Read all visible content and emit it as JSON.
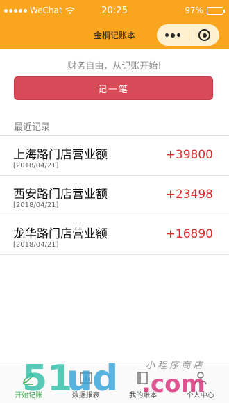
{
  "status_bar": {
    "carrier": "WeChat",
    "time": "20:25",
    "battery": "97%",
    "battery_level": 0.97
  },
  "nav": {
    "title": "金桐记账本"
  },
  "main": {
    "slogan": "财务自由，从记账开始!",
    "record_button": "记一笔",
    "section_title": "最近记录",
    "records": [
      {
        "name": "上海路门店营业额",
        "date": "[2018/04/21]",
        "amount": "+39800"
      },
      {
        "name": "西安路门店营业额",
        "date": "[2018/04/21]",
        "amount": "+23498"
      },
      {
        "name": "龙华路门店营业额",
        "date": "[2018/04/21]",
        "amount": "+16890"
      }
    ]
  },
  "tabs": [
    {
      "label": "开始记账",
      "icon": "pencil-icon"
    },
    {
      "label": "数据报表",
      "icon": "chart-icon"
    },
    {
      "label": "我的账本",
      "icon": "book-icon"
    },
    {
      "label": "个人中心",
      "icon": "user-icon"
    }
  ],
  "watermark": {
    "logo": "51ud.com",
    "tagline": "小程序商店"
  },
  "colors": {
    "header": "#f9a51d",
    "button": "#d84a57",
    "amount": "#e02b2b",
    "active_tab": "#3aa44a"
  }
}
